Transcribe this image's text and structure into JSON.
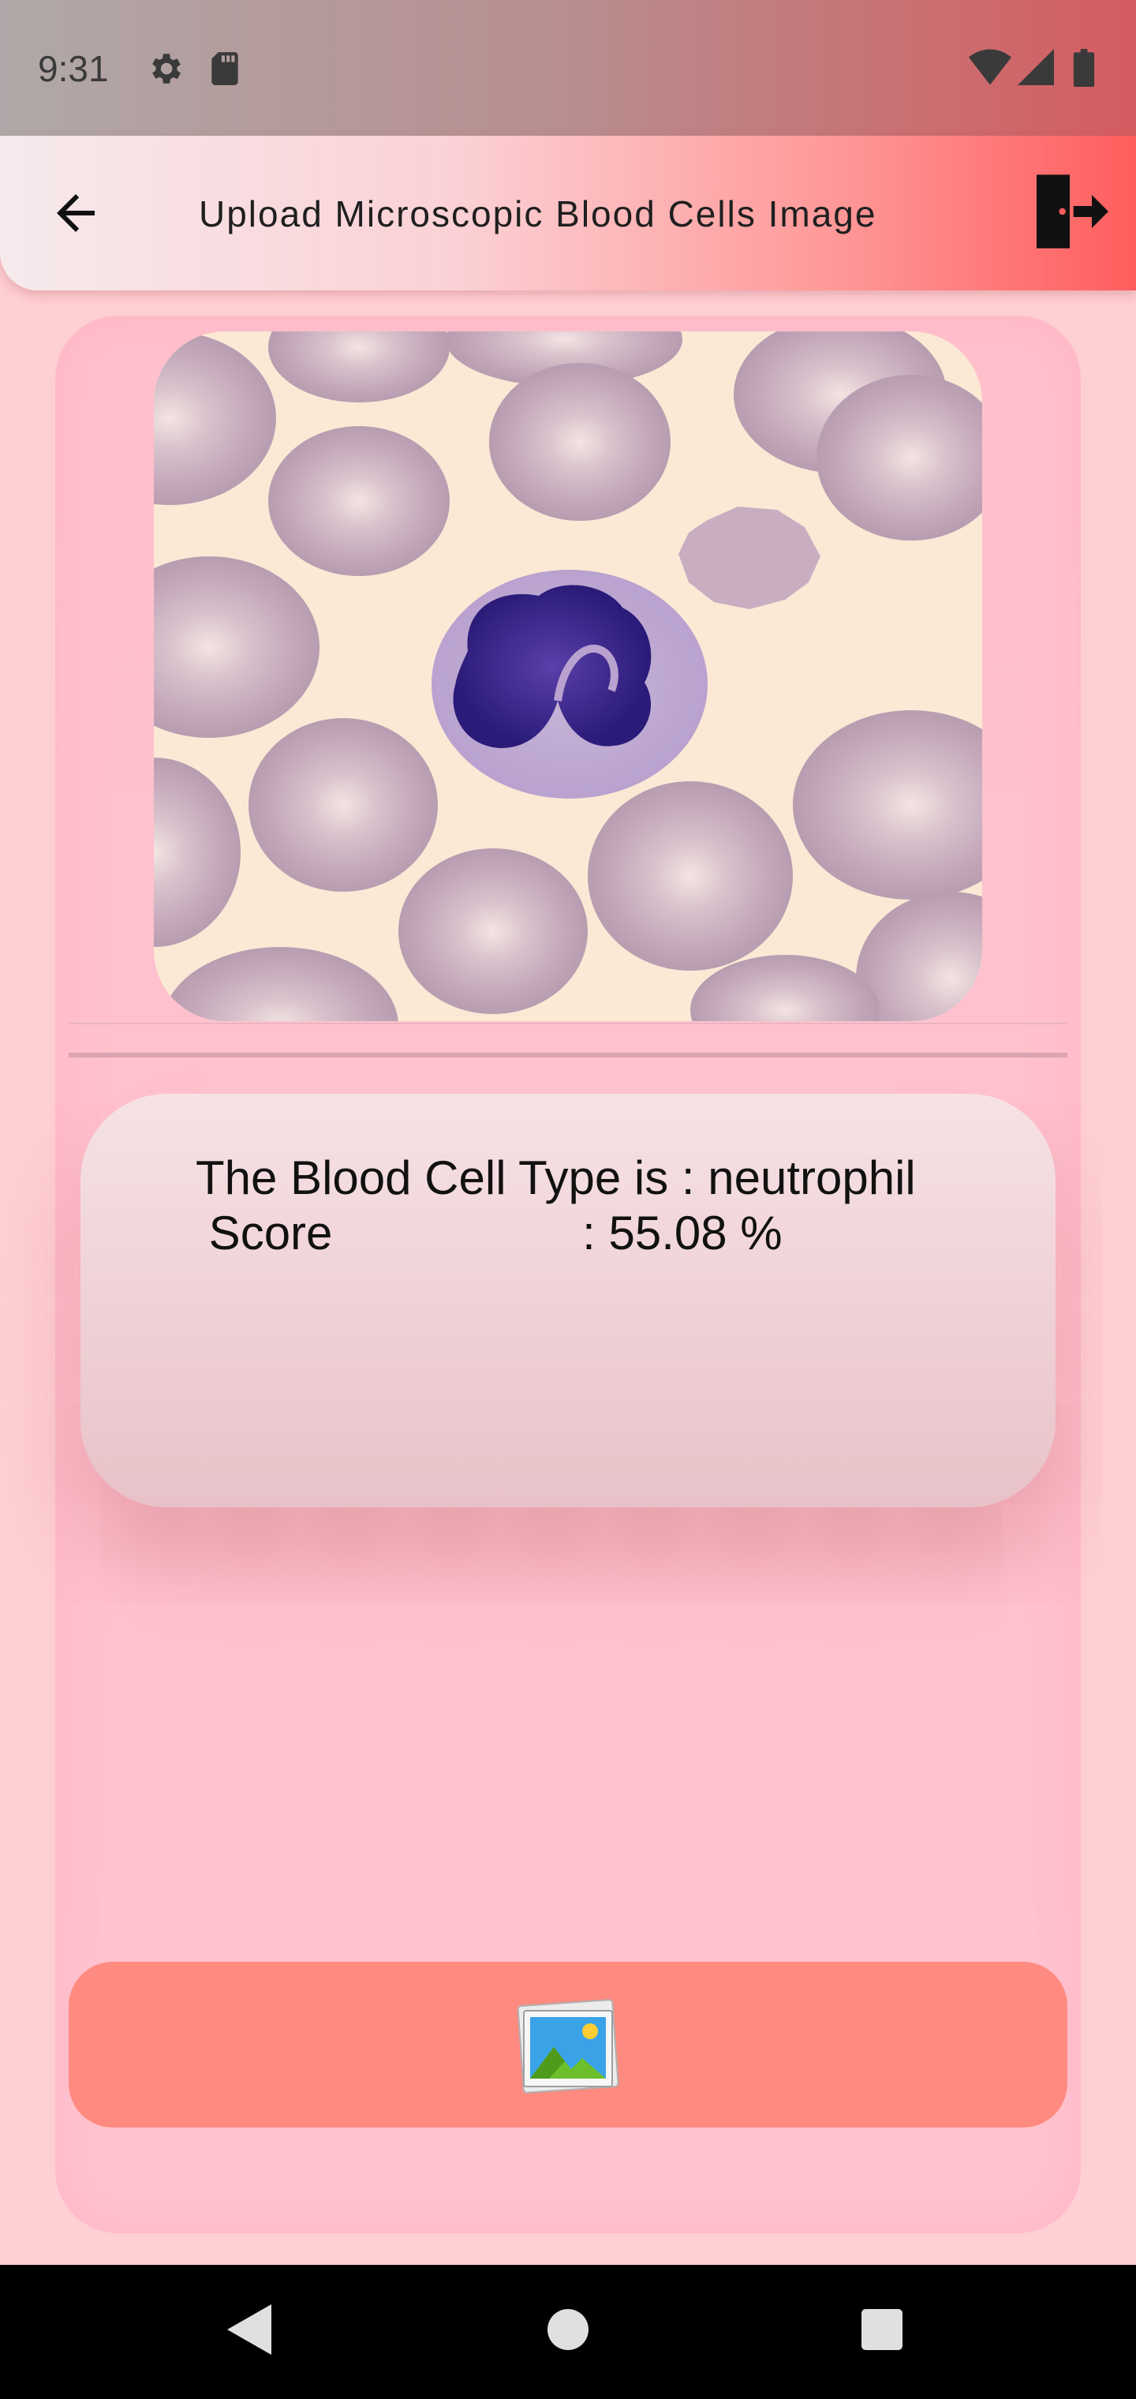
{
  "status_bar": {
    "time": "9:31",
    "icons": [
      "settings-icon",
      "sd-card-icon",
      "wifi-icon",
      "cell-signal-icon",
      "battery-icon"
    ]
  },
  "app_bar": {
    "title": "Upload Microscopic Blood Cells Image",
    "back_icon": "arrow-back-icon",
    "logout_icon": "logout-icon",
    "gradient_colors": [
      "#f6eaec",
      "#ff5d5d"
    ]
  },
  "result": {
    "line1": "The Blood Cell Type is : neutrophil",
    "line2": " Score                   : 55.08 %"
  },
  "upload_button": {
    "icon": "image-gallery-icon",
    "color": "#ff8a80"
  },
  "navigation_bar": {
    "buttons": [
      "back-nav-icon",
      "home-nav-icon",
      "recents-nav-icon"
    ]
  },
  "colors": {
    "background": "#ffd0d3",
    "card": "#ffc0cc",
    "result_box": "#f6e2e5",
    "upload_button": "#ff8a80"
  }
}
